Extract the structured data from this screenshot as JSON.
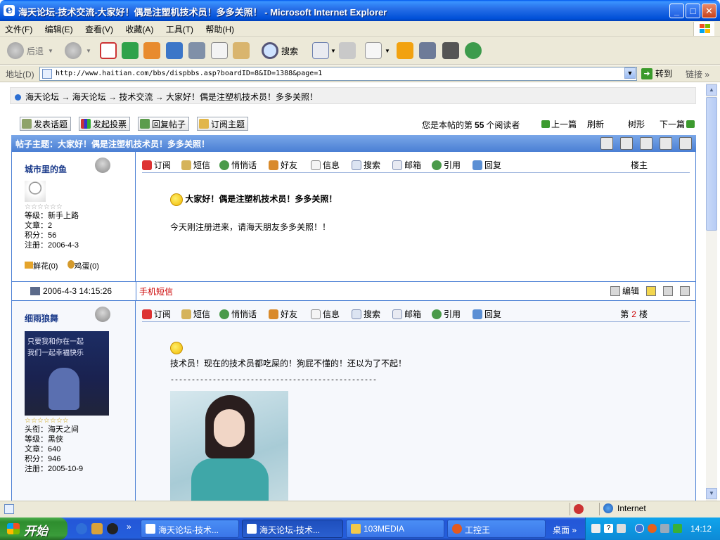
{
  "window": {
    "title": "海天论坛-技术交流-大家好！偶是注塑机技术员！多多关照！ - Microsoft Internet Explorer"
  },
  "menu": {
    "items": [
      "文件(F)",
      "编辑(E)",
      "查看(V)",
      "收藏(A)",
      "工具(T)",
      "帮助(H)"
    ]
  },
  "toolbar": {
    "back_label": "后退",
    "search_label": "搜索"
  },
  "address": {
    "label": "地址(D)",
    "url": "http://www.haitian.com/bbs/dispbbs.asp?boardID=8&ID=1388&page=1",
    "go_label": "转到",
    "links_label": "链接"
  },
  "breadcrumb": {
    "text": "海天论坛 → 海天论坛 → 技术交流 → 大家好！偶是注塑机技术员！多多关照！"
  },
  "actions": {
    "new_topic": "发表话题",
    "new_poll": "发起投票",
    "reply_post": "回复帖子",
    "subscribe_topic": "订阅主题",
    "read_prefix": "您是本帖的第",
    "read_count": "55",
    "read_suffix": "个阅读者",
    "prev": "上一篇",
    "refresh": "刷新",
    "tree": "树形",
    "next": "下一篇"
  },
  "topic": {
    "title": "帖子主题：大家好！偶是注塑机技术员！多多关照！"
  },
  "post_tools": [
    "订阅",
    "短信",
    "悄悄话",
    "好友",
    "信息",
    "搜索",
    "邮箱",
    "引用",
    "回复"
  ],
  "posts": [
    {
      "username": "城市里的鱼",
      "stars": "☆☆☆☆☆☆",
      "level": "等级：新手上路",
      "articles": "文章：2",
      "points": "积分：56",
      "registered": "注册：2006-4-3",
      "flower": "鲜花(0)",
      "egg": "鸡蛋(0)",
      "floor_label": "楼主",
      "subject": "大家好！偶是注塑机技术员！多多关照！",
      "body": "今天刚注册进来，请海天朋友多多关照！！",
      "time": "2006-4-3 14:15:26",
      "sms": "手机短信",
      "edit": "编辑"
    },
    {
      "username": "细雨狼舞",
      "stars": "☆☆☆☆☆☆☆",
      "title_line": "头衔：海天之间",
      "level": "等级：黑侠",
      "articles": "文章：640",
      "points": "积分：946",
      "registered": "注册：2005-10-9",
      "floor_prefix": "第",
      "floor_num": "2",
      "floor_suffix": "楼",
      "body": "技术员！现在的技术员都吃屎的！狗屁不懂的！还以为了不起！",
      "divider": "-------------------------------------------------",
      "avatar_text1": "只要我和你在一起",
      "avatar_text2": "我们一起幸福快乐"
    }
  ],
  "status": {
    "zone": "Internet"
  },
  "taskbar": {
    "start": "开始",
    "tasks": [
      "海天论坛-技术...",
      "海天论坛-技术...",
      "103MEDIA",
      "工控王"
    ],
    "desktop": "桌面",
    "clock": "14:12"
  }
}
